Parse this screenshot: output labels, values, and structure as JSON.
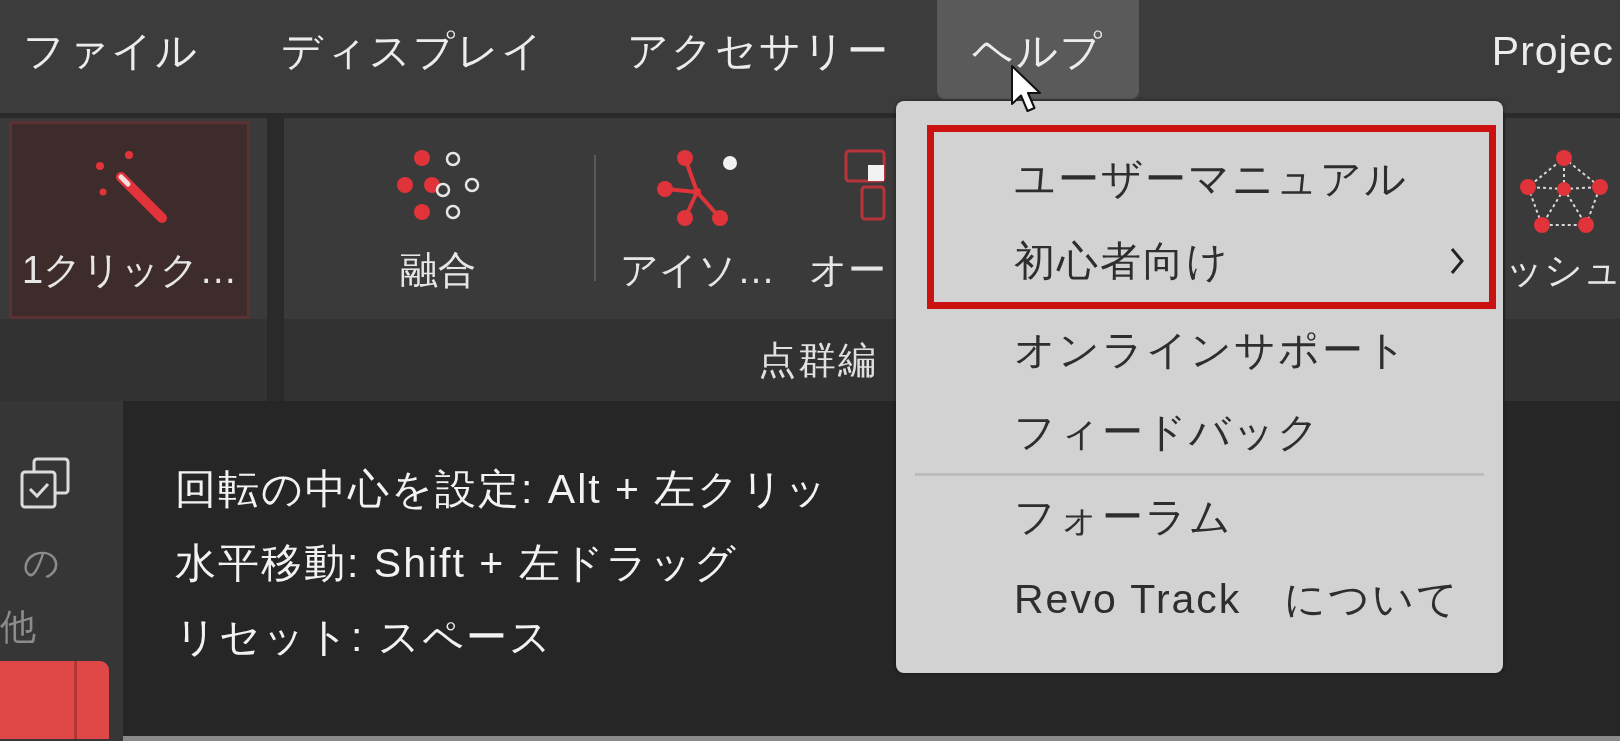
{
  "menu_bar": {
    "items": [
      {
        "label": "ファイル",
        "selected": false
      },
      {
        "label": "ディスプレイ",
        "selected": false
      },
      {
        "label": "アクセサリー",
        "selected": false
      },
      {
        "label": "ヘルプ",
        "selected": true
      }
    ],
    "project": "Projec"
  },
  "ribbon": {
    "groups": [
      {
        "sections": [
          {
            "buttons": [
              {
                "label": "1クリック…",
                "selected": true
              }
            ]
          }
        ]
      },
      {
        "label": "点群編",
        "sections": [
          {
            "buttons": [
              {
                "label": "融合",
                "selected": false
              }
            ]
          },
          {
            "buttons": [
              {
                "label": "アイソ…",
                "selected": false
              },
              {
                "label": "オー",
                "selected": false
              }
            ]
          }
        ]
      },
      {
        "sections": [
          {
            "buttons": [
              {
                "label": "ッシュ",
                "selected": false
              }
            ]
          }
        ]
      }
    ]
  },
  "sidebar": {
    "label_lines": [
      "の",
      "他"
    ]
  },
  "viewport": {
    "hints": [
      "回転の中心を設定: Alt + 左クリッ",
      "水平移動: Shift + 左ドラッグ",
      "リセット: スペース"
    ]
  },
  "help_menu": {
    "sections": [
      {
        "items": [
          {
            "label": "ユーザーマニュアル",
            "highlighted": true,
            "submenu": false
          },
          {
            "label": "初心者向け",
            "highlighted": true,
            "submenu": true
          },
          {
            "label": "オンラインサポート",
            "highlighted": false,
            "submenu": false
          },
          {
            "label": "フィードバック",
            "highlighted": false,
            "submenu": false
          }
        ]
      },
      {
        "items": [
          {
            "label": "フォーラム",
            "highlighted": false,
            "submenu": false
          },
          {
            "label": "Revo Track　について",
            "highlighted": false,
            "submenu": false
          }
        ]
      }
    ]
  }
}
